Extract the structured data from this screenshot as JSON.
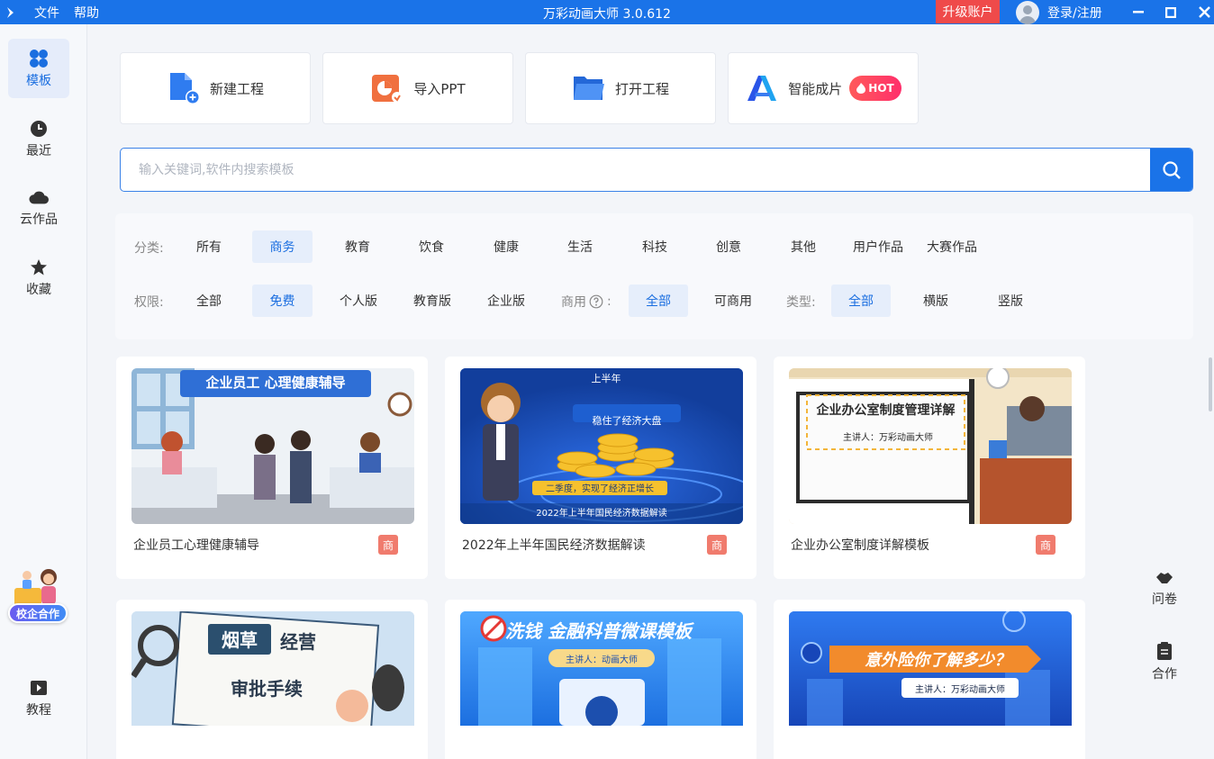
{
  "titlebar": {
    "menu": [
      "文件",
      "帮助"
    ],
    "title": "万彩动画大师 3.0.612",
    "upgrade_label": "升级账户",
    "login_label": "登录/注册"
  },
  "sidebar": {
    "items": [
      {
        "label": "模板",
        "icon": "grid-icon"
      },
      {
        "label": "最近",
        "icon": "clock-icon"
      },
      {
        "label": "云作品",
        "icon": "cloud-icon"
      },
      {
        "label": "收藏",
        "icon": "star-icon"
      }
    ],
    "promo_label": "校企合作",
    "tutorial_label": "教程"
  },
  "actions": [
    {
      "label": "新建工程"
    },
    {
      "label": "导入PPT"
    },
    {
      "label": "打开工程"
    },
    {
      "label": "智能成片",
      "badge": "HOT"
    }
  ],
  "search": {
    "placeholder": "输入关键词,软件内搜索模板"
  },
  "filters": {
    "category_label": "分类:",
    "categories": [
      "所有",
      "商务",
      "教育",
      "饮食",
      "健康",
      "生活",
      "科技",
      "创意",
      "其他",
      "用户作品",
      "大赛作品"
    ],
    "category_selected": "商务",
    "permission_label": "权限:",
    "permissions": [
      "全部",
      "免费",
      "个人版",
      "教育版",
      "企业版"
    ],
    "permission_selected": "免费",
    "commercial_label": "商用",
    "commercial_options": [
      "全部",
      "可商用"
    ],
    "commercial_selected": "全部",
    "type_label": "类型:",
    "types": [
      "全部",
      "横版",
      "竖版"
    ],
    "type_selected": "全部"
  },
  "templates": [
    {
      "name": "企业员工心理健康辅导",
      "badge": "商",
      "thumb_text": "企业员工 心理健康辅导"
    },
    {
      "name": "2022年上半年国民经济数据解读",
      "badge": "商",
      "thumb_text": "上半年",
      "thumb_sub1": "稳住了经济大盘",
      "thumb_sub2": "二季度，实现了经济正增长",
      "thumb_sub3": "2022年上半年国民经济数据解读"
    },
    {
      "name": "企业办公室制度详解模板",
      "badge": "商",
      "thumb_text": "企业办公室制度管理详解",
      "thumb_sub1": "主讲人：万彩动画大师"
    },
    {
      "name": "",
      "thumb_text": "烟草",
      "thumb_sub1": "经营",
      "thumb_sub2": "审批手续"
    },
    {
      "name": "",
      "thumb_text": "洗钱 金融科普微课模板",
      "thumb_sub1": "主讲人：动画大师"
    },
    {
      "name": "",
      "thumb_text": "意外险你了解多少？",
      "thumb_sub1": "主讲人：万彩动画大师"
    }
  ],
  "right_tools": [
    {
      "label": "问卷"
    },
    {
      "label": "合作"
    }
  ],
  "colors": {
    "primary": "#1a73e8",
    "upgrade": "#ef4a4a",
    "badge": "#f07b6d",
    "selected_bg": "#e6eefb"
  }
}
